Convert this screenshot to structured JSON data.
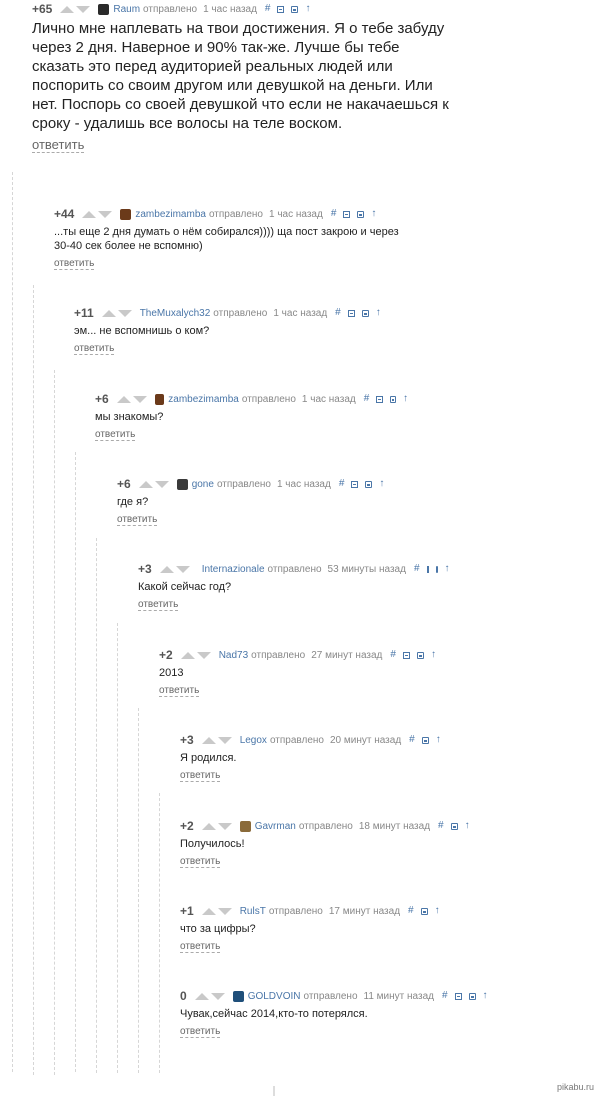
{
  "meta": {
    "posted_label": "отправлено",
    "reply_label": "ответить",
    "hash_label": "#",
    "up_label": "↑"
  },
  "comments": [
    {
      "score": "+65",
      "author": "Raum",
      "time": "1 час назад",
      "avatar_color": "#2a2a2a",
      "text": "Лично мне наплевать на твои достижения. Я о тебе забуду через 2 дня. Наверное и 90% так-же. Лучше бы тебе сказать это перед аудиторией реальных людей или поспорить со своим другом или девушкой на деньги. Или нет. Поспорь со своей девушкой что если не накачаешься к сроку - удалишь все волосы на теле воском."
    },
    {
      "score": "+44",
      "author": "zambezimamba",
      "time": "1 час назад",
      "avatar_color": "#6b3a1a",
      "text": "...ты еще 2 дня думать о нём собирался)))) ща пост закрою и через 30-40 сек более не вспомню)"
    },
    {
      "score": "+11",
      "author": "TheMuxalych32",
      "time": "1 час назад",
      "avatar_color": "",
      "text": "эм... не вспомнишь о ком?"
    },
    {
      "score": "+6",
      "author": "zambezimamba",
      "time": "1 час назад",
      "avatar_color": "#6b3a1a",
      "text": "мы знакомы?"
    },
    {
      "score": "+6",
      "author": "gone",
      "time": "1 час назад",
      "avatar_color": "#3a3a3a",
      "text": "где я?"
    },
    {
      "score": "+3",
      "author": "Internazionale",
      "time": "53 минуты назад",
      "avatar_color": "#111111",
      "text": "Какой сейчас год?"
    },
    {
      "score": "+2",
      "author": "Nad73",
      "time": "27 минут назад",
      "avatar_color": "",
      "text": "2013"
    },
    {
      "score": "+3",
      "author": "Legox",
      "time": "20 минут назад",
      "avatar_color": "",
      "text": "Я родился."
    },
    {
      "score": "+2",
      "author": "Gavrman",
      "time": "18 минут назад",
      "avatar_color": "#8a6a3a",
      "text": "Получилось!"
    },
    {
      "score": "+1",
      "author": "RulsT",
      "time": "17 минут назад",
      "avatar_color": "",
      "text": "что за цифры?"
    },
    {
      "score": "0",
      "author": "GOLDVOIN",
      "time": "11 минут назад",
      "avatar_color": "#1f4f7a",
      "text": "Чувак,сейчас 2014,кто-то потерялся."
    }
  ],
  "footer": {
    "watermark": "pikabu.ru"
  }
}
